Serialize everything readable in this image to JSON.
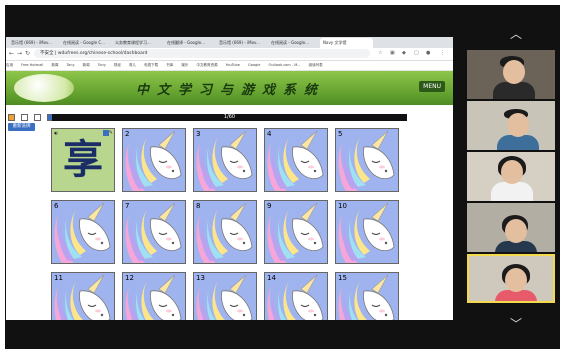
{
  "browser": {
    "tabs": [
      "音乐馆 (669) - iMov...",
      "在线阅读 - Google C...",
      "义务教育课程学习...",
      "在线翻译 - Google...",
      "音乐馆 (669) - iMov...",
      "在线阅读 - Google...",
      "Navy 文学馆"
    ],
    "url": "不安全 | wdufrees.org/chinese-school/dashboard",
    "bookmarks": [
      "应用",
      "Free Hotmail",
      "新闻",
      "Tony",
      "新闻",
      "Tony",
      "财经",
      "育儿",
      "电视下载",
      "书库",
      "娱乐",
      "中文教育资源",
      "YouTube",
      "Google",
      "Outlook.com - M...",
      "阅读列表"
    ]
  },
  "site": {
    "title": "中文学习与游戏系统",
    "menu_label": "MENU",
    "progress_text": "1/60",
    "reset_label": "重新洗牌"
  },
  "cards": [
    {
      "number": "",
      "character": "享",
      "revealed": true
    },
    {
      "number": "2",
      "character": "",
      "revealed": false
    },
    {
      "number": "3",
      "character": "",
      "revealed": false
    },
    {
      "number": "4",
      "character": "",
      "revealed": false
    },
    {
      "number": "5",
      "character": "",
      "revealed": false
    },
    {
      "number": "6",
      "character": "",
      "revealed": false
    },
    {
      "number": "7",
      "character": "",
      "revealed": false
    },
    {
      "number": "8",
      "character": "",
      "revealed": false
    },
    {
      "number": "9",
      "character": "",
      "revealed": false
    },
    {
      "number": "10",
      "character": "",
      "revealed": false
    },
    {
      "number": "11",
      "character": "",
      "revealed": false
    },
    {
      "number": "12",
      "character": "",
      "revealed": false
    },
    {
      "number": "13",
      "character": "",
      "revealed": false
    },
    {
      "number": "14",
      "character": "",
      "revealed": false
    },
    {
      "number": "15",
      "character": "",
      "revealed": false
    }
  ],
  "participants": [
    {
      "id": "p1",
      "active": false
    },
    {
      "id": "p2",
      "active": false
    },
    {
      "id": "p3",
      "active": false
    },
    {
      "id": "p4",
      "active": false
    },
    {
      "id": "p5",
      "active": true
    }
  ],
  "colors": {
    "card_back": "#9fb3ee",
    "card_revealed": "#b8d68e",
    "banner_green": "#5b9a2a",
    "active_speaker": "#f3d94b"
  },
  "icons": [
    "chevron-up-icon",
    "chevron-down-icon",
    "speaker-icon",
    "pin-icon"
  ]
}
